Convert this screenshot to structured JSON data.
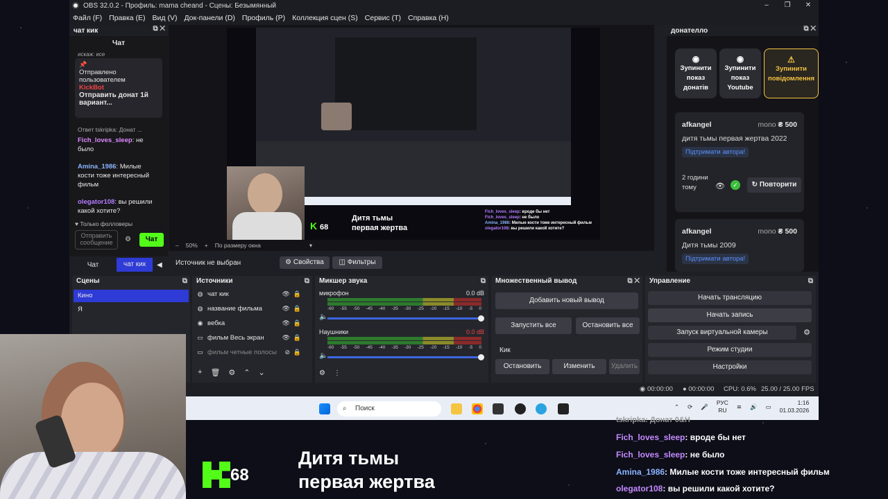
{
  "window": {
    "title": "OBS 32.0.2 - Профиль: mama cheand - Сцены: Безымянный",
    "minimize": "–",
    "maximize": "❐",
    "close": "✕"
  },
  "menu": [
    "Файл (F)",
    "Правка (E)",
    "Вид (V)",
    "Док-панели (D)",
    "Профиль (P)",
    "Коллекция сцен (S)",
    "Сервис (T)",
    "Справка (H)"
  ],
  "chat_dock": {
    "title": "чат кик",
    "tab": "Чат",
    "truncated_top": "искаж: исе",
    "pinned_label": "Отправлено пользователем",
    "pinned_user": "KickBot",
    "pinned_text": "Отправить донат 1й вариант...",
    "reply": "Ответ tskripka: Донат ...",
    "messages": [
      {
        "user": "Fich_loves_sleep",
        "text": "не было"
      },
      {
        "user": "Amina_1986",
        "text": "Милые кости тоже интересный фильм"
      },
      {
        "user": "olegator108",
        "text": "вы решили какой хотите?"
      }
    ],
    "followers_only": "Только фолловеры",
    "input_placeholder": "Отправить сообщение",
    "send": "Чат",
    "bottom_tabs": [
      "Чат",
      "чат кик"
    ]
  },
  "preview": {
    "zoom": "50%",
    "fit": "По размеру окна",
    "overlay_number": "68",
    "movie_title_line1": "Дитя тьмы",
    "movie_title_line2": "первая жертва",
    "nested_chat": [
      {
        "user": "Fich_loves_sleep",
        "text": "вроде бы нет"
      },
      {
        "user": "Fich_loves_sleep",
        "text": "не было"
      },
      {
        "user": "Amina_1986",
        "text": "Милые кости тоже интересный фильм"
      },
      {
        "user": "olegator108",
        "text": "вы решили какой хотите?"
      }
    ]
  },
  "source_bar": {
    "none_selected": "Источник не выбран",
    "properties": "Свойства",
    "filters": "Фильтры"
  },
  "scenes": {
    "title": "Сцены",
    "items": [
      "Кино",
      "Я"
    ]
  },
  "sources": {
    "title": "Источники",
    "items": [
      "чат кик",
      "название фильма",
      "вебка",
      "фильм Весь экран",
      "фильм четные полосы"
    ]
  },
  "mixer": {
    "title": "Микшер звука",
    "channels": [
      {
        "name": "микрофон",
        "db": "0.0 dB"
      },
      {
        "name": "Наушники",
        "db": "0.0 dB"
      }
    ],
    "scale": [
      "-60",
      "-55",
      "-50",
      "-45",
      "-40",
      "-35",
      "-30",
      "-25",
      "-20",
      "-15",
      "-10",
      "-5",
      "0"
    ]
  },
  "multi_output": {
    "title": "Множественный вывод",
    "add": "Добавить новый вывод",
    "start_all": "Запустить все",
    "stop_all": "Остановить все",
    "target": "Кик",
    "stop": "Остановить",
    "edit": "Изменить",
    "delete": "Удалить"
  },
  "controls": {
    "title": "Управление",
    "buttons": [
      "Начать трансляцию",
      "Начать запись",
      "Запуск виртуальной камеры",
      "Режим студии",
      "Настройки"
    ]
  },
  "status": {
    "t1": "00:00:00",
    "t2": "00:00:00",
    "cpu": "CPU: 0.6%",
    "fps": "25.00 / 25.00 FPS"
  },
  "taskbar": {
    "search": "Поиск",
    "lang1": "РУС",
    "lang2": "RU",
    "time": "1:16",
    "date": "01.03.2026"
  },
  "donatello": {
    "title": "донателло",
    "buttons": [
      "Зупинити показ донатів",
      "Зупинити показ Youtube",
      "Зупинити повідомлення"
    ],
    "cards": [
      {
        "user": "afkangel",
        "method": "mono",
        "amount": "₴ 500",
        "text": "дитя тьмы первая жертва 2022",
        "support": "Підтримати автора!",
        "ago": "2 години тому",
        "repeat": "Повторити"
      },
      {
        "user": "afkangel",
        "method": "mono",
        "amount": "₴ 500",
        "text": "Дитя тьмы 2009",
        "support": "Підтримати автора!"
      }
    ]
  },
  "overlay": {
    "number": "68",
    "title_line1": "Дитя тьмы",
    "title_line2": "первая жертва",
    "truncated_top": "tskripka: Донат 0&H",
    "chat": [
      {
        "user": "Fich_loves_sleep",
        "text": "вроде бы нет"
      },
      {
        "user": "Fich_loves_sleep",
        "text": "не было"
      },
      {
        "user": "Amina_1986",
        "text": "Милые кости тоже интересный фильм"
      },
      {
        "user": "olegator108",
        "text": "вы решили какой хотите?"
      }
    ]
  }
}
